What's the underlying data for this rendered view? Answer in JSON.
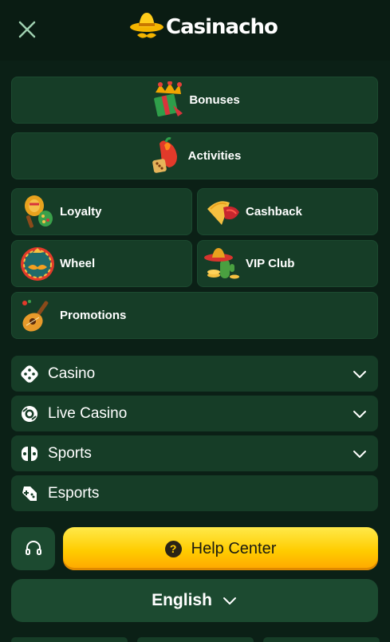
{
  "header": {
    "logo_text": "Casinacho"
  },
  "featured": [
    {
      "label": "Bonuses",
      "icon": "gift-box-icon"
    },
    {
      "label": "Activities",
      "icon": "chili-dice-icon"
    }
  ],
  "grid": {
    "loyalty": {
      "label": "Loyalty",
      "icon": "maracas-icon"
    },
    "cashback": {
      "label": "Cashback",
      "icon": "nachos-icon"
    },
    "wheel": {
      "label": "Wheel",
      "icon": "mustache-wheel-icon"
    },
    "vip": {
      "label": "VIP Club",
      "icon": "sombrero-cactus-icon"
    },
    "promotions": {
      "label": "Promotions",
      "icon": "guitar-icon"
    }
  },
  "sections": [
    {
      "label": "Casino",
      "icon": "dice-icon",
      "expandable": true
    },
    {
      "label": "Live Casino",
      "icon": "chip-icon",
      "expandable": true
    },
    {
      "label": "Sports",
      "icon": "ball-icon",
      "expandable": true
    },
    {
      "label": "Esports",
      "icon": "gamepad-icon",
      "expandable": false
    }
  ],
  "footer": {
    "help_label": "Help Center",
    "help_icon_text": "?",
    "language_label": "English"
  },
  "colors": {
    "background": "#0b2016",
    "tile": "#163d27",
    "accent_yellow": "#ffcc00",
    "close_icon": "#9fd0b0"
  }
}
